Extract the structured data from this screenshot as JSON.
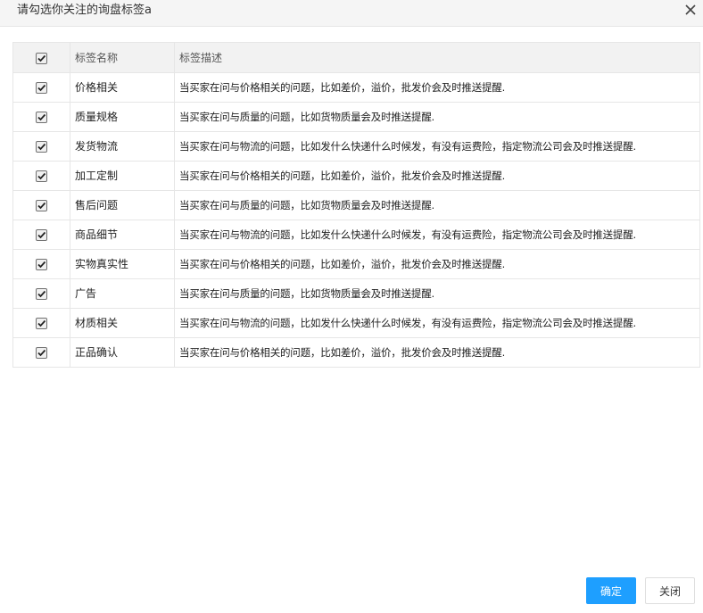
{
  "dialog": {
    "title": "请勾选你关注的询盘标签a"
  },
  "table": {
    "header_checkbox_checked": true,
    "columns": [
      "标签名称",
      "标签描述"
    ],
    "rows": [
      {
        "checked": true,
        "name": "价格相关",
        "desc": "当买家在问与价格相关的问题，比如差价，溢价，批发价会及时推送提醒."
      },
      {
        "checked": true,
        "name": "质量规格",
        "desc": "当买家在问与质量的问题，比如货物质量会及时推送提醒."
      },
      {
        "checked": true,
        "name": "发货物流",
        "desc": "当买家在问与物流的问题，比如发什么快递什么时候发，有没有运费险，指定物流公司会及时推送提醒."
      },
      {
        "checked": true,
        "name": "加工定制",
        "desc": "当买家在问与价格相关的问题，比如差价，溢价，批发价会及时推送提醒."
      },
      {
        "checked": true,
        "name": "售后问题",
        "desc": "当买家在问与质量的问题，比如货物质量会及时推送提醒."
      },
      {
        "checked": true,
        "name": "商品细节",
        "desc": "当买家在问与物流的问题，比如发什么快递什么时候发，有没有运费险，指定物流公司会及时推送提醒."
      },
      {
        "checked": true,
        "name": "实物真实性",
        "desc": "当买家在问与价格相关的问题，比如差价，溢价，批发价会及时推送提醒."
      },
      {
        "checked": true,
        "name": "广告",
        "desc": "当买家在问与质量的问题，比如货物质量会及时推送提醒."
      },
      {
        "checked": true,
        "name": "材质相关",
        "desc": "当买家在问与物流的问题，比如发什么快递什么时候发，有没有运费险，指定物流公司会及时推送提醒."
      },
      {
        "checked": true,
        "name": "正品确认",
        "desc": "当买家在问与价格相关的问题，比如差价，溢价，批发价会及时推送提醒."
      }
    ]
  },
  "footer": {
    "confirm_label": "确定",
    "close_label": "关闭"
  },
  "colors": {
    "primary": "#1e9fff",
    "header_bg": "#f5f5f5",
    "table_header_bg": "#f2f2f2",
    "border": "#e6e6e6"
  },
  "icons": {
    "close": "close-icon",
    "checkbox": "checkbox-checked-icon"
  }
}
